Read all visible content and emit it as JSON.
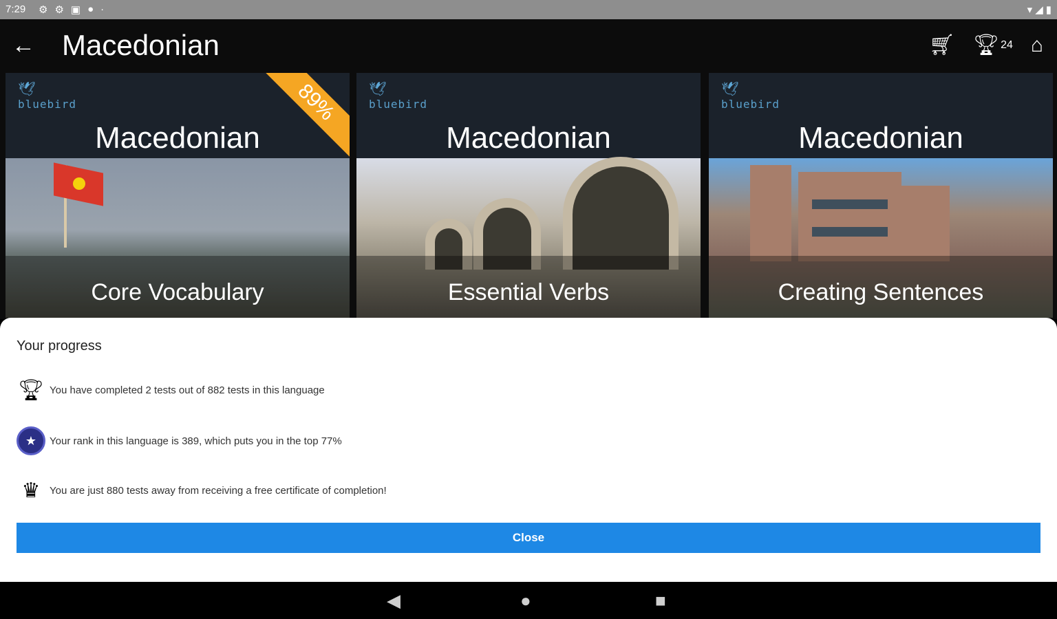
{
  "status_bar": {
    "time": "7:29",
    "left_icons": [
      "gear-icon",
      "gear-icon",
      "sim-icon",
      "circle-icon",
      "dot-icon"
    ],
    "right_icons": [
      "wifi-icon",
      "signal-icon",
      "battery-icon"
    ]
  },
  "app_bar": {
    "title": "Macedonian",
    "back_icon": "arrow-back-icon",
    "cart_icon": "cart-icon",
    "trophy_icon": "trophy-icon",
    "trophy_count": "24",
    "home_icon": "home-icon"
  },
  "cards": [
    {
      "brand": "bluebird",
      "language": "Macedonian",
      "topic": "Core Vocabulary",
      "badge": "89%"
    },
    {
      "brand": "bluebird",
      "language": "Macedonian",
      "topic": "Essential Verbs"
    },
    {
      "brand": "bluebird",
      "language": "Macedonian",
      "topic": "Creating Sentences"
    }
  ],
  "progress_sheet": {
    "title": "Your progress",
    "items": [
      {
        "icon": "star-trophy-icon",
        "text": "You have completed 2 tests out of 882 tests in this language"
      },
      {
        "icon": "rank-badge-icon",
        "text": "Your rank in this language is 389, which puts you in the top 77%"
      },
      {
        "icon": "crown-icon",
        "text": "You are just 880 tests away from receiving a free certificate of completion!"
      }
    ],
    "close_label": "Close"
  },
  "nav_bar": {
    "back_icon": "nav-back-icon",
    "home_icon": "nav-home-icon",
    "recents_icon": "nav-recents-icon"
  },
  "colors": {
    "accent": "#1e88e5",
    "ribbon": "#f5a623",
    "card_bg": "#1b222b",
    "brand_blue": "#5aa0cc"
  }
}
